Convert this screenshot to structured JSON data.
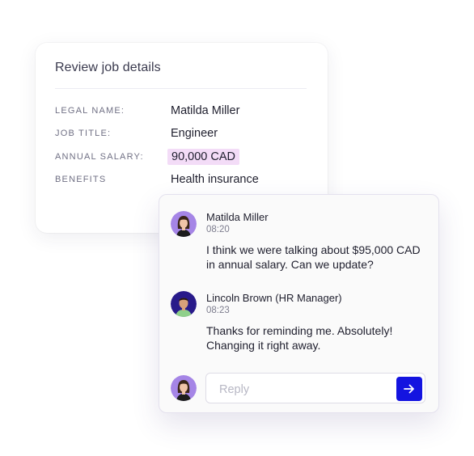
{
  "job_details": {
    "title": "Review job details",
    "fields": [
      {
        "label": "LEGAL NAME:",
        "value": "Matilda Miller",
        "highlighted": false
      },
      {
        "label": "JOB TITLE:",
        "value": "Engineer",
        "highlighted": false
      },
      {
        "label": "ANNUAL SALARY:",
        "value": "90,000 CAD",
        "highlighted": true
      },
      {
        "label": "BENEFITS",
        "value": "Health insurance",
        "highlighted": false
      }
    ]
  },
  "chat": {
    "messages": [
      {
        "author": "Matilda Miller",
        "time": "08:20",
        "text": "I think we were talking about $95,000 CAD in annual salary. Can we update?",
        "avatar": "woman-avatar"
      },
      {
        "author": "Lincoln Brown (HR Manager)",
        "time": "08:23",
        "text": "Thanks for reminding me. Absolutely! Changing it right away.",
        "avatar": "man-avatar"
      }
    ],
    "reply": {
      "placeholder": "Reply",
      "value": "",
      "send_icon": "arrow-right-icon"
    }
  },
  "colors": {
    "accent": "#1414e0",
    "highlight": "#f3dcf7",
    "avatar_bg_purple": "#a585e6",
    "avatar_bg_navy": "#281a8a"
  }
}
